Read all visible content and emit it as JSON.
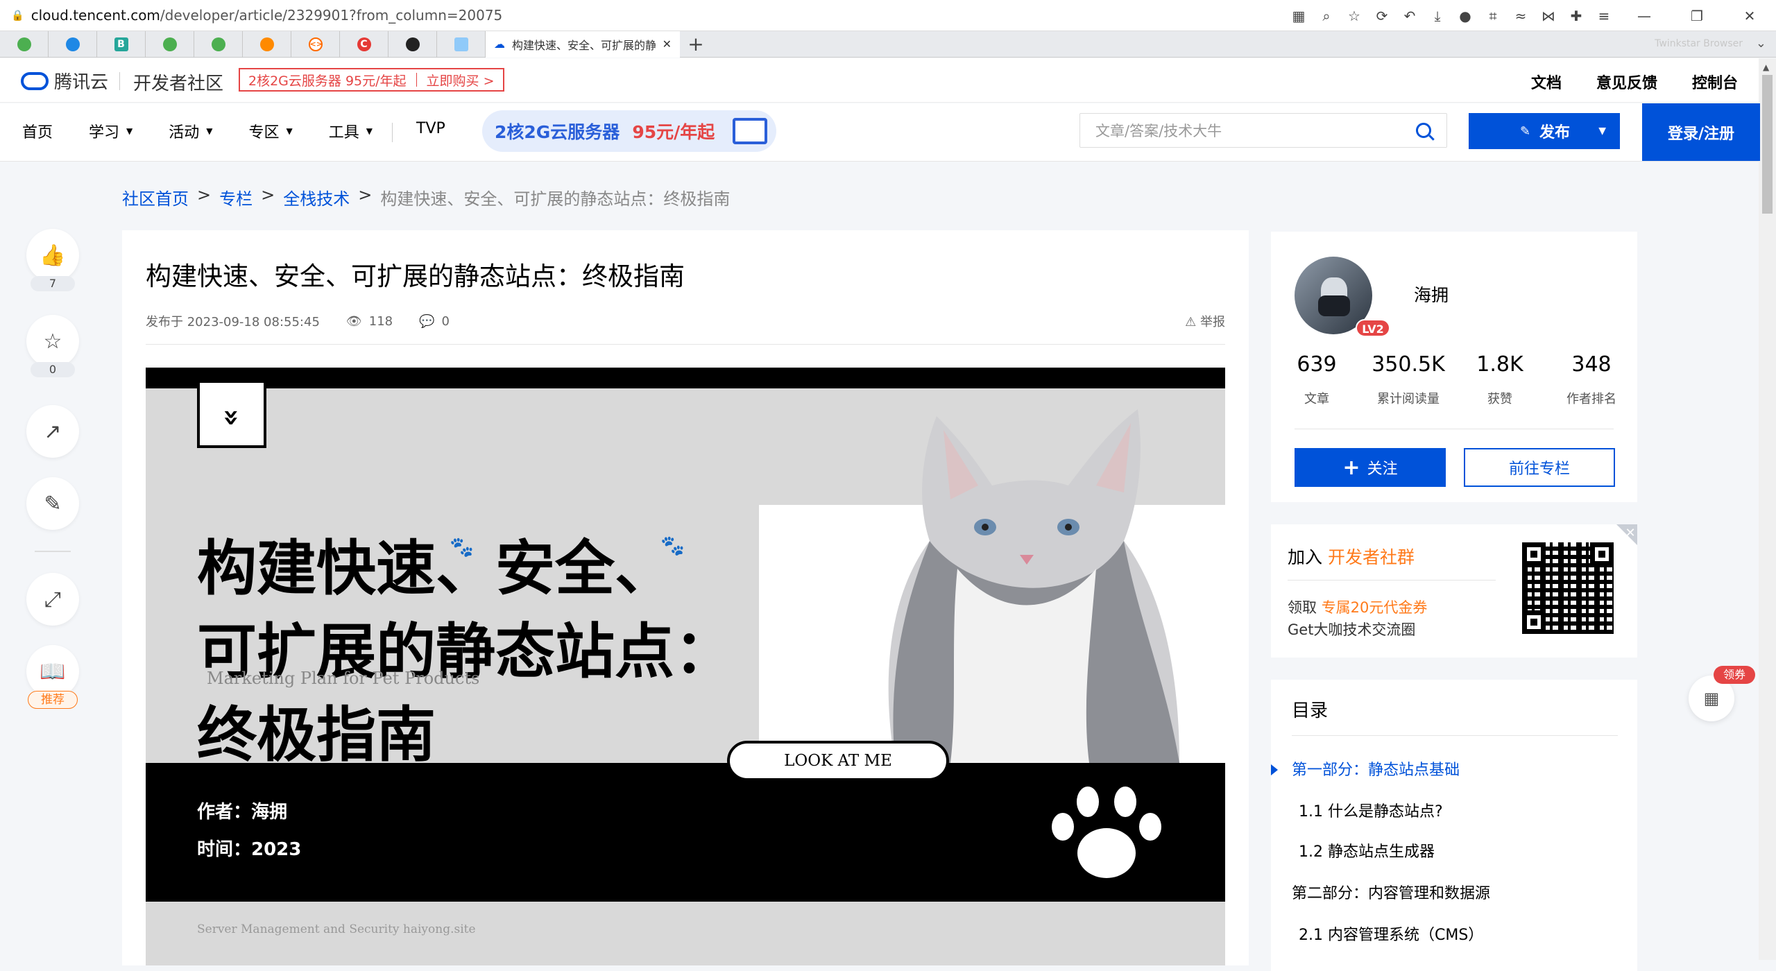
{
  "browser": {
    "url_host": "cloud.tencent.com",
    "url_path": "/developer/article/2329901?from_column=20075",
    "active_tab_title": "构建快速、安全、可扩展的静态",
    "brand_tag": "Twinkstar Browser"
  },
  "site": {
    "brand": "腾讯云",
    "community": "开发者社区",
    "promo_left": "2核2G云服务器 95元/年起",
    "promo_right": "立即购买 >",
    "head_links": [
      "文档",
      "意见反馈",
      "控制台"
    ],
    "nav": [
      "首页",
      "学习",
      "活动",
      "专区",
      "工具"
    ],
    "tvp": "TVP",
    "nav_promo_a": "2核2G云服务器",
    "nav_promo_b": "95元/年起",
    "search_placeholder": "文章/答案/技术大牛",
    "publish": "发布",
    "login": "登录/注册"
  },
  "breadcrumb": {
    "home": "社区首页",
    "column": "专栏",
    "category": "全栈技术",
    "current": "构建快速、安全、可扩展的静态站点：终极指南",
    "sep": ">"
  },
  "rail": {
    "likes": "7",
    "favorites": "0",
    "recommend": "推荐"
  },
  "article": {
    "title": "构建快速、安全、可扩展的静态站点：终极指南",
    "published": "发布于 2023-09-18 08:55:45",
    "views": "118",
    "comments": "0",
    "report": "举报"
  },
  "cover": {
    "headline_1": "构建快速、安全、",
    "headline_2": "可扩展的静态站点：",
    "headline_3": "终极指南",
    "subtitle": "Marketing Plan for Pet Products",
    "author": "作者：海拥",
    "time": "时间：2023",
    "look": "LOOK AT ME",
    "footer": "Server Management and Security  haiyong.site"
  },
  "author": {
    "name": "海拥",
    "level": "LV2",
    "stats": [
      {
        "value": "639",
        "label": "文章"
      },
      {
        "value": "350.5K",
        "label": "累计阅读量"
      },
      {
        "value": "1.8K",
        "label": "获赞"
      },
      {
        "value": "348",
        "label": "作者排名"
      }
    ],
    "follow": "关注",
    "goto": "前往专栏"
  },
  "join": {
    "prefix": "加入",
    "group": "开发者社群",
    "line1_prefix": "领取",
    "line1_highlight": "专属20元代金券",
    "line2": "Get大咖技术交流圈"
  },
  "toc": {
    "title": "目录",
    "items": [
      "第一部分：静态站点基础",
      "1.1 什么是静态站点?",
      "1.2 静态站点生成器",
      "第二部分：内容管理和数据源",
      "2.1 内容管理系统（CMS）"
    ]
  },
  "float": {
    "coupon": "领券"
  },
  "colors": {
    "primary": "#0052d9",
    "danger": "#e54545",
    "orange": "#ff7a1a"
  }
}
